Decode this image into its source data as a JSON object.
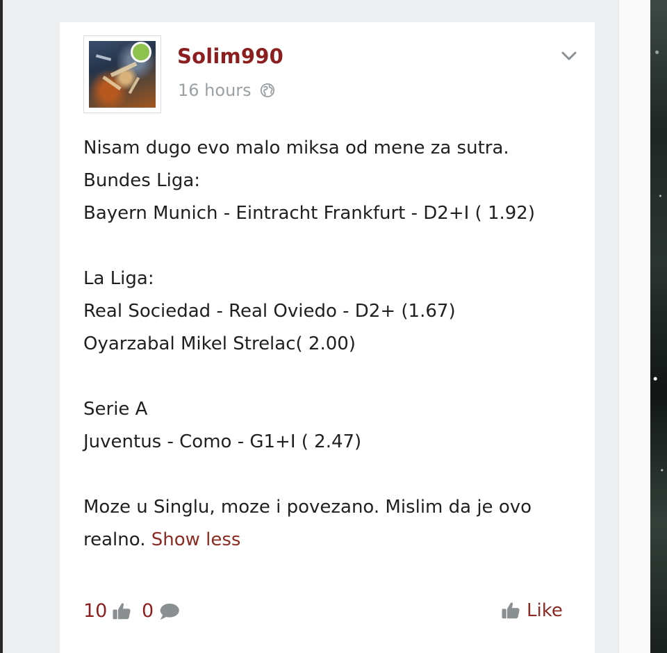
{
  "post": {
    "author": "Solim990",
    "timestamp": "16 hours",
    "visibility_icon": "globe-icon",
    "menu_icon": "chevron-down-icon",
    "avatar": {
      "online_status": "online",
      "status_color": "#8dc24f"
    },
    "body": [
      "Nisam dugo evo malo miksa od mene za sutra.",
      "Bundes Liga:",
      "Bayern Munich - Eintracht Frankfurt - D2+I ( 1.92)",
      "",
      "La Liga:",
      "Real Sociedad - Real Oviedo - D2+ (1.67)",
      "Oyarzabal Mikel Strelac( 2.00)",
      "",
      "Serie A",
      "Juventus - Como - G1+I ( 2.47)",
      "",
      "Moze u Singlu, moze i povezano. Mislim da je ovo",
      "realno."
    ],
    "show_less_label": "Show less",
    "likes_count": "10",
    "comments_count": "0",
    "like_label": "Like"
  },
  "colors": {
    "accent": "#8b1f1f",
    "link": "#8b2b22",
    "muted_text": "#9aa0a3",
    "body_text": "#1f1f1f",
    "page_background": "#eceeef",
    "card_background": "#ffffff"
  }
}
